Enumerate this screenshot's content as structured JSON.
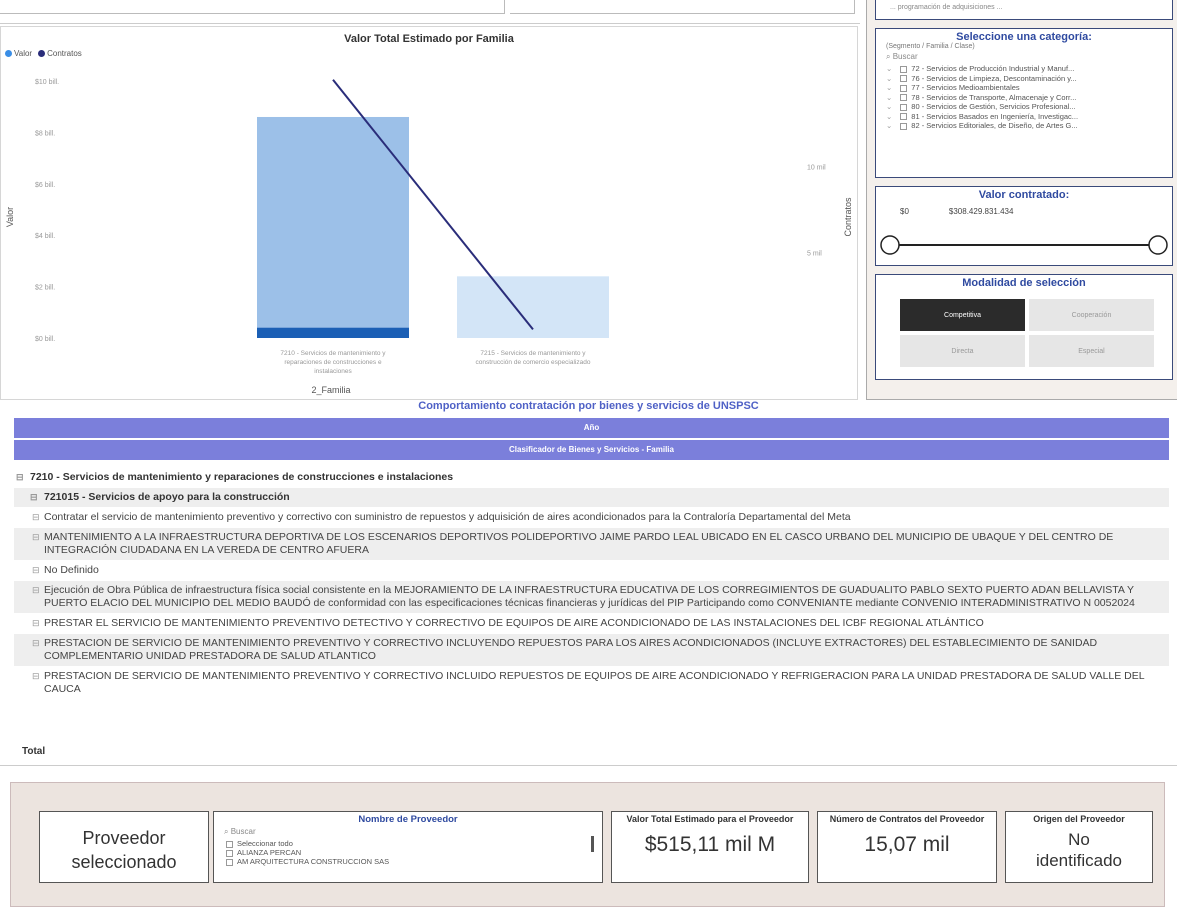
{
  "chart": {
    "title": "Valor Total Estimado por Familia",
    "legend": [
      {
        "label": "Valor",
        "color": "#3a8ee6"
      },
      {
        "label": "Contratos",
        "color": "#2a2d7a"
      }
    ],
    "ylabel_left": "Valor",
    "ylabel_right": "Contratos",
    "xlabel": "2_Familia",
    "y_ticks_left": [
      "$10 bill.",
      "$8 bill.",
      "$6 bill.",
      "$4 bill.",
      "$2 bill.",
      "$0 bill."
    ],
    "y_ticks_right": [
      "10 mil",
      "5 mil"
    ]
  },
  "chart_data": {
    "type": "bar",
    "categories": [
      "7210 - Servicios de mantenimiento y reparaciones de construcciones e instalaciones",
      "7215 - Servicios de mantenimiento y construcción de comercio especializado"
    ],
    "series": [
      {
        "name": "Valor",
        "values": [
          8.6,
          2.4
        ],
        "colors": [
          "#9cc0e8",
          "#d3e5f7"
        ]
      },
      {
        "name": "Contratos",
        "values": [
          15.07,
          0.5
        ]
      }
    ],
    "highlight_values": [
      0.4,
      0.0
    ],
    "ylim_left": [
      0,
      10
    ],
    "ylim_right": [
      0,
      15
    ],
    "xlabel": "2_Familia",
    "ylabel": "Valor"
  },
  "right": {
    "partial_top_text": "... programación de adquisiciones ...",
    "category": {
      "title": "Seleccione una categoría:",
      "subtitle": "(Segmento / Familia / Clase)",
      "search": "Buscar",
      "items": [
        "72 - Servicios de Producción Industrial y Manuf...",
        "76 - Servicios de Limpieza, Descontaminación y...",
        "77 - Servicios Medioambientales",
        "78 - Servicios de Transporte, Almacenaje y Corr...",
        "80 - Servicios de Gestión, Servicios Profesional...",
        "81 - Servicios Basados en Ingeniería, Investigac...",
        "82 - Servicios Editoriales, de Diseño, de Artes G..."
      ]
    },
    "valor": {
      "title": "Valor contratado:",
      "min": "$0",
      "max": "$308.429.831.434"
    },
    "modalidad": {
      "title": "Modalidad de selección",
      "options": [
        "Competitiva",
        "Cooperación",
        "Directa",
        "Especial"
      ]
    }
  },
  "table": {
    "title": "Comportamiento contratación por bienes y servicios de UNSPSC",
    "header1": "Año",
    "header2": "Clasificador de Bienes y Servicios - Familia",
    "rows": [
      {
        "level": 1,
        "text": "7210 - Servicios de mantenimiento y reparaciones de construcciones e instalaciones"
      },
      {
        "level": 2,
        "text": "721015 - Servicios de apoyo para la construcción"
      },
      {
        "level": 3,
        "text": "Contratar el servicio de mantenimiento preventivo y correctivo con suministro de repuestos y adquisición de aires acondicionados para la Contraloría Departamental del Meta"
      },
      {
        "level": 3,
        "text": "MANTENIMIENTO A LA INFRAESTRUCTURA DEPORTIVA DE LOS ESCENARIOS DEPORTIVOS POLIDEPORTIVO JAIME PARDO LEAL UBICADO EN EL CASCO URBANO DEL MUNICIPIO DE UBAQUE Y DEL CENTRO DE INTEGRACIÓN CIUDADANA EN LA VEREDA DE CENTRO AFUERA"
      },
      {
        "level": 3,
        "text": "No Definido"
      },
      {
        "level": 3,
        "text": "Ejecución de Obra Pública de infraestructura física social consistente en la MEJORAMIENTO DE LA INFRAESTRUCTURA EDUCATIVA DE LOS CORREGIMIENTOS DE GUADUALITO PABLO SEXTO PUERTO ADAN BELLAVISTA Y PUERTO ELACIO DEL MUNICIPIO DEL MEDIO BAUDÓ de conformidad con las especificaciones técnicas financieras y jurídicas del PIP Participando como CONVENIANTE mediante CONVENIO INTERADMINISTRATIVO N 0052024"
      },
      {
        "level": 3,
        "text": "PRESTAR EL SERVICIO DE MANTENIMIENTO PREVENTIVO DETECTIVO Y CORRECTIVO DE EQUIPOS DE AIRE ACONDICIONADO DE LAS INSTALACIONES DEL ICBF REGIONAL ATLÁNTICO"
      },
      {
        "level": 3,
        "text": "PRESTACION DE SERVICIO DE MANTENIMIENTO PREVENTIVO Y CORRECTIVO INCLUYENDO REPUESTOS PARA LOS AIRES ACONDICIONADOS (INCLUYE EXTRACTORES) DEL ESTABLECIMIENTO DE SANIDAD COMPLEMENTARIO UNIDAD PRESTADORA DE SALUD ATLANTICO"
      },
      {
        "level": 3,
        "text": "PRESTACION DE SERVICIO DE MANTENIMIENTO PREVENTIVO Y CORRECTIVO INCLUIDO REPUESTOS DE EQUIPOS DE AIRE ACONDICIONADO Y REFRIGERACION PARA LA UNIDAD PRESTADORA DE SALUD VALLE DEL CAUCA"
      }
    ],
    "total": "Total"
  },
  "bottom": {
    "selected_label": "Proveedor seleccionado",
    "provider_title": "Nombre de Proveedor",
    "provider_search": "Buscar",
    "provider_items": [
      "Seleccionar todo",
      "ALIANZA PERCAN",
      "AM ARQUITECTURA CONSTRUCCION SAS"
    ],
    "valor_head": "Valor Total Estimado para el Proveedor",
    "valor_value": "$515,11 mil M",
    "contratos_head": "Número de Contratos del Proveedor",
    "contratos_value": "15,07 mil",
    "origen_head": "Origen del Proveedor",
    "origen_value": "No identificado"
  }
}
